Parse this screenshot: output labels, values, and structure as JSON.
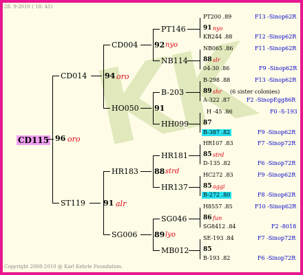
{
  "header": {
    "date": "28. 9-2010 ( 18: 45)"
  },
  "footer": {
    "copyright": "Copyright 2008-2010 @ Karl Kehrle Foundation."
  },
  "watermark": {
    "text": "KK"
  },
  "root": {
    "name": "CD115",
    "num": "96",
    "color": "oro"
  },
  "gen1": [
    {
      "name": "CD014",
      "num": "94",
      "color": "oro"
    },
    {
      "name": "ST119",
      "num": "91",
      "color": "alr"
    }
  ],
  "gen2": [
    {
      "name": "CD004",
      "num": "92",
      "color": "nyo"
    },
    {
      "name": "HO050",
      "num": "91",
      "color": ""
    },
    {
      "name": "HR183",
      "num": "88",
      "color": "strd"
    },
    {
      "name": "SG006",
      "num": "89",
      "color": "lyo"
    }
  ],
  "gen3": [
    {
      "name": "PT146",
      "num": "91",
      "color": "nyo"
    },
    {
      "name": "NB114",
      "num": "88",
      "color": "slr"
    },
    {
      "name": "B-203",
      "num": "89",
      "color": "shr",
      "note": "(6 sister colonies)"
    },
    {
      "name": "HH099",
      "num": "87",
      "color": ""
    },
    {
      "name": "HR181",
      "num": "85",
      "color": "strd"
    },
    {
      "name": "HR137",
      "num": "85",
      "color": "aggi"
    },
    {
      "name": "SG046",
      "num": "86",
      "color": "fun"
    },
    {
      "name": "MB012",
      "num": "85",
      "color": ""
    }
  ],
  "gen4": [
    {
      "name": "PT200",
      "score": ".89",
      "code": "F13 -Sinop62R"
    },
    {
      "name": "KB244",
      "score": ".88",
      "code": "F12 -Sinop62R"
    },
    {
      "name": "NB065",
      "score": ".86",
      "code": "F11 -Sinop62R"
    },
    {
      "name": "04-30",
      "score": ".86",
      "code": "F9 -Sinop62R"
    },
    {
      "name": "B-298",
      "score": ".88",
      "code": "F13 -Sinop62R"
    },
    {
      "name": "A-322",
      "score": ".87",
      "code": "F2 -SinopEgg86R"
    },
    {
      "name": "H -45",
      "score": ".86",
      "code": "F0 -S-193"
    },
    {
      "name": "B-387",
      "score": ".82",
      "code": "F9 -Sinop62R"
    },
    {
      "name": "HR107",
      "score": ".83",
      "code": "F7 -Sinop72R"
    },
    {
      "name": "D-135",
      "score": ".82",
      "code": "F6 -Sinop72R"
    },
    {
      "name": "HC272",
      "score": ".83",
      "code": "F9 -Sinop62R"
    },
    {
      "name": "B-272",
      "score": ".80",
      "code": "F8 -Sinop62R"
    },
    {
      "name": "H8557",
      "score": ".85",
      "code": "F10 -Sinop62R"
    },
    {
      "name": "SG8412",
      "score": ".84",
      "code": "F2 -8018"
    },
    {
      "name": "SE-193",
      "score": ".84",
      "code": "F7 -Sinop72R"
    },
    {
      "name": "B-193",
      "score": ".82",
      "code": "F6 -Sinop72R"
    }
  ]
}
